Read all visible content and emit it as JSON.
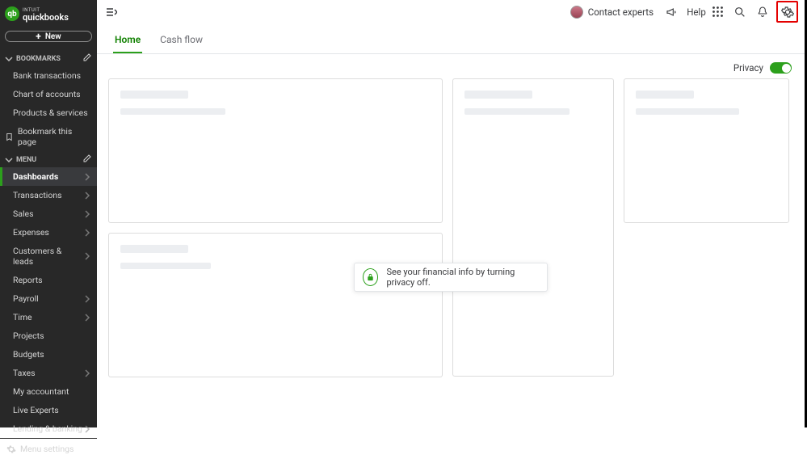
{
  "brand": {
    "name_small": "INTUIT",
    "name": "quickbooks",
    "symbol": "qb"
  },
  "new_btn": "New",
  "sections": {
    "bookmarks_label": "BOOKMARKS",
    "menu_label": "MENU"
  },
  "bookmarks": [
    {
      "label": "Bank transactions"
    },
    {
      "label": "Chart of accounts"
    },
    {
      "label": "Products & services"
    },
    {
      "label": "Bookmark this page",
      "icon": true
    }
  ],
  "menu": [
    {
      "label": "Dashboards",
      "chev": true,
      "active": true
    },
    {
      "label": "Transactions",
      "chev": true
    },
    {
      "label": "Sales",
      "chev": true
    },
    {
      "label": "Expenses",
      "chev": true
    },
    {
      "label": "Customers & leads",
      "chev": true
    },
    {
      "label": "Reports",
      "chev": false
    },
    {
      "label": "Payroll",
      "chev": true
    },
    {
      "label": "Time",
      "chev": true
    },
    {
      "label": "Projects",
      "chev": false
    },
    {
      "label": "Budgets",
      "chev": false
    },
    {
      "label": "Taxes",
      "chev": true
    },
    {
      "label": "My accountant",
      "chev": false
    },
    {
      "label": "Live Experts",
      "chev": false
    },
    {
      "label": "Lending & banking",
      "chev": true
    }
  ],
  "menu_settings": "Menu settings",
  "topbar": {
    "contact_experts": "Contact experts",
    "help": "Help"
  },
  "tabs": [
    {
      "label": "Home",
      "active": true
    },
    {
      "label": "Cash flow"
    }
  ],
  "privacy": {
    "label": "Privacy",
    "on": true
  },
  "tip": "See your financial info by turning privacy off."
}
